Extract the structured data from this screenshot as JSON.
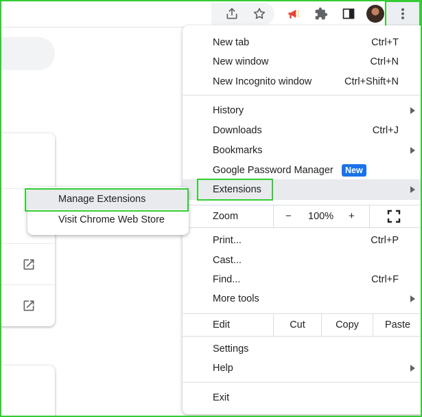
{
  "menu": {
    "new_tab": {
      "label": "New tab",
      "shortcut": "Ctrl+T"
    },
    "new_window": {
      "label": "New window",
      "shortcut": "Ctrl+N"
    },
    "new_incognito": {
      "label": "New Incognito window",
      "shortcut": "Ctrl+Shift+N"
    },
    "history": {
      "label": "History"
    },
    "downloads": {
      "label": "Downloads",
      "shortcut": "Ctrl+J"
    },
    "bookmarks": {
      "label": "Bookmarks"
    },
    "password_manager": {
      "label": "Google Password Manager",
      "badge": "New"
    },
    "extensions": {
      "label": "Extensions"
    },
    "zoom": {
      "label": "Zoom",
      "minus": "−",
      "level": "100%",
      "plus": "+"
    },
    "print": {
      "label": "Print...",
      "shortcut": "Ctrl+P"
    },
    "cast": {
      "label": "Cast..."
    },
    "find": {
      "label": "Find...",
      "shortcut": "Ctrl+F"
    },
    "more_tools": {
      "label": "More tools"
    },
    "edit": {
      "label": "Edit",
      "cut": "Cut",
      "copy": "Copy",
      "paste": "Paste"
    },
    "settings": {
      "label": "Settings"
    },
    "help": {
      "label": "Help"
    },
    "exit": {
      "label": "Exit"
    }
  },
  "extensions_submenu": {
    "manage": "Manage Extensions",
    "web_store": "Visit Chrome Web Store"
  },
  "toolbar": {
    "icons": [
      "share-icon",
      "bookmark-star-icon",
      "megaphone-icon",
      "extensions-puzzle-icon",
      "side-panel-icon",
      "profile-avatar",
      "kebab-menu-icon"
    ]
  },
  "colors": {
    "highlight_outline": "#33cc33",
    "new_badge": "#1a73e8",
    "megaphone": "#ea4335",
    "hover_bg": "#e8eaed"
  }
}
